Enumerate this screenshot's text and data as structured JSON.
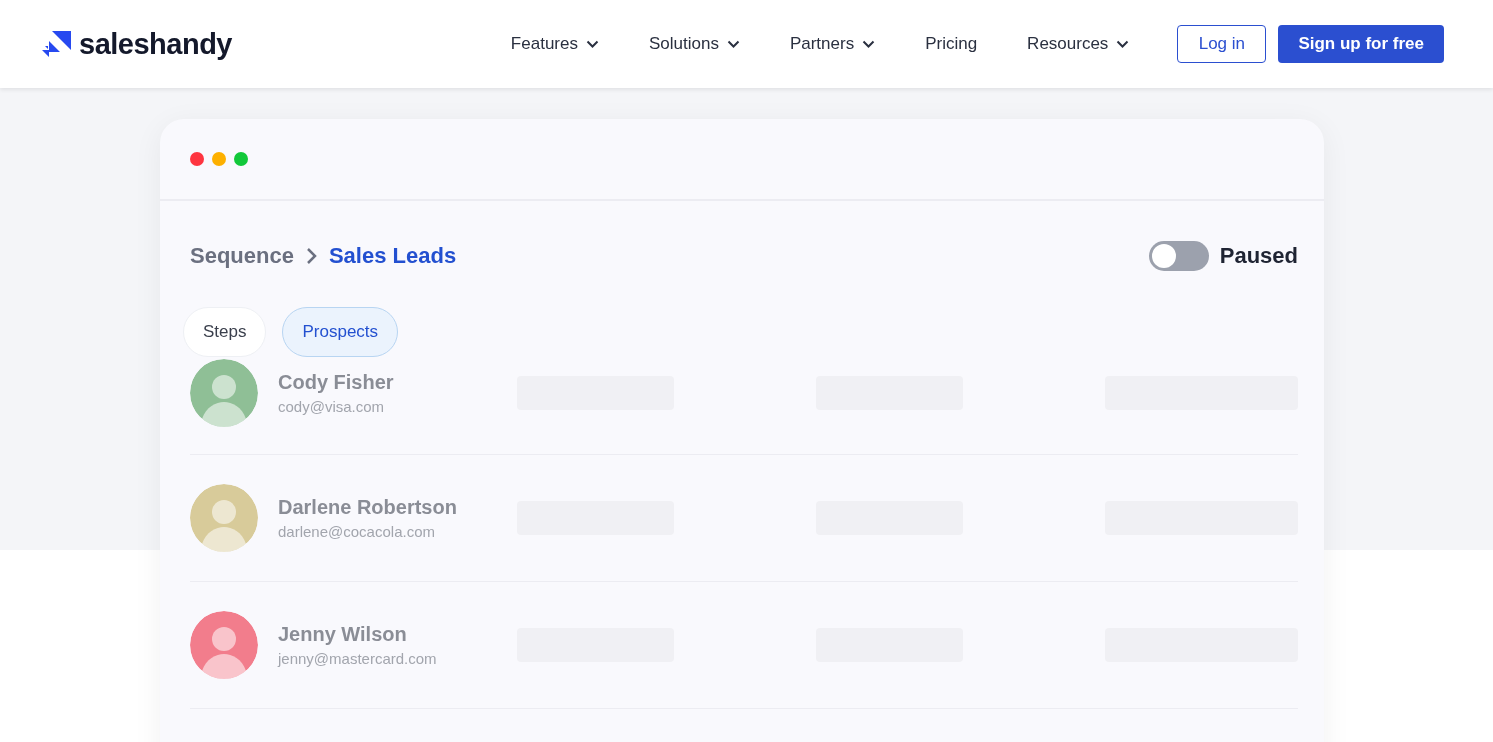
{
  "header": {
    "logo_text": "saleshandy",
    "nav": [
      {
        "label": "Features",
        "dropdown": true
      },
      {
        "label": "Solutions",
        "dropdown": true
      },
      {
        "label": "Partners",
        "dropdown": true
      },
      {
        "label": "Pricing",
        "dropdown": false
      },
      {
        "label": "Resources",
        "dropdown": true
      }
    ],
    "login": "Log in",
    "signup": "Sign up for free"
  },
  "window": {
    "breadcrumb": {
      "parent": "Sequence",
      "current": "Sales Leads"
    },
    "status_toggle": {
      "label": "Paused",
      "on": false
    },
    "tabs": [
      {
        "label": "Steps",
        "selected": false
      },
      {
        "label": "Prospects",
        "selected": true
      }
    ],
    "prospects": [
      {
        "name": "Cody Fisher",
        "email": "cody@visa.com",
        "color": "#8fbf96"
      },
      {
        "name": "Darlene Robertson",
        "email": "darlene@cocacola.com",
        "color": "#d8cb9a"
      },
      {
        "name": "Jenny Wilson",
        "email": "jenny@mastercard.com",
        "color": "#f27d8c"
      }
    ]
  }
}
